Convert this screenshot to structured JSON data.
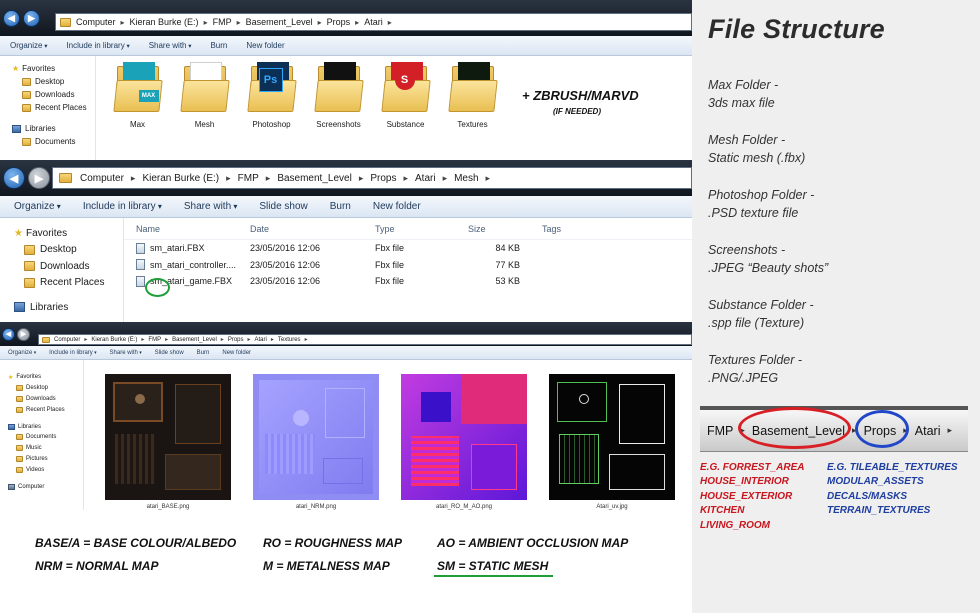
{
  "window1": {
    "breadcrumb": [
      "Computer",
      "Kieran Burke (E:)",
      "FMP",
      "Basement_Level",
      "Props",
      "Atari"
    ],
    "toolbar": [
      "Organize",
      "Include in library",
      "Share with",
      "Burn",
      "New folder"
    ],
    "nav": [
      {
        "label": "Favorites",
        "type": "group",
        "icon": "star-icon"
      },
      {
        "label": "Desktop",
        "type": "sub",
        "icon": "desktop-icon"
      },
      {
        "label": "Downloads",
        "type": "sub",
        "icon": "downloads-icon"
      },
      {
        "label": "Recent Places",
        "type": "sub",
        "icon": "recent-places-icon"
      },
      {
        "label": "",
        "type": "gap"
      },
      {
        "label": "Libraries",
        "type": "group",
        "icon": "libraries-icon"
      },
      {
        "label": "Documents",
        "type": "sub",
        "icon": "documents-icon"
      }
    ],
    "folders": [
      {
        "label": "Max",
        "badge": "MAX",
        "badge_color": "#1aa3b8"
      },
      {
        "label": "Mesh",
        "badge": "",
        "badge_color": ""
      },
      {
        "label": "Photoshop",
        "badge": "Ps",
        "badge_color": "#0b2f55"
      },
      {
        "label": "Screenshots",
        "badge": "",
        "badge_color": "#111111"
      },
      {
        "label": "Substance",
        "badge": "S",
        "badge_color": "#d32027"
      },
      {
        "label": "Textures",
        "badge": "",
        "badge_color": "#0d1a0d"
      }
    ],
    "extra_note": "+ ZBRUSH/MARVD",
    "extra_note_sub": "(IF NEEDED)"
  },
  "window2": {
    "breadcrumb": [
      "Computer",
      "Kieran Burke (E:)",
      "FMP",
      "Basement_Level",
      "Props",
      "Atari",
      "Mesh"
    ],
    "toolbar": [
      "Organize",
      "Include in library",
      "Share with",
      "Slide show",
      "Burn",
      "New folder"
    ],
    "nav": [
      {
        "label": "Favorites",
        "type": "group",
        "icon": "star-icon"
      },
      {
        "label": "Desktop",
        "type": "sub",
        "icon": "desktop-icon"
      },
      {
        "label": "Downloads",
        "type": "sub",
        "icon": "downloads-icon"
      },
      {
        "label": "Recent Places",
        "type": "sub",
        "icon": "recent-places-icon"
      },
      {
        "label": "",
        "type": "gap"
      },
      {
        "label": "Libraries",
        "type": "group",
        "icon": "libraries-icon"
      }
    ],
    "columns": [
      "Name",
      "Date",
      "Type",
      "Size",
      "Tags"
    ],
    "files": [
      {
        "name": "sm_atari.FBX",
        "date": "23/05/2016 12:06",
        "type": "Fbx file",
        "size": "84 KB"
      },
      {
        "name": "sm_atari_controller....",
        "date": "23/05/2016 12:06",
        "type": "Fbx file",
        "size": "77 KB"
      },
      {
        "name": "sm_atari_game.FBX",
        "date": "23/05/2016 12:06",
        "type": "Fbx file",
        "size": "53 KB"
      }
    ]
  },
  "window3": {
    "breadcrumb": [
      "Computer",
      "Kieran Burke (E:)",
      "FMP",
      "Basement_Level",
      "Props",
      "Atari",
      "Textures"
    ],
    "toolbar": [
      "Organize",
      "Include in library",
      "Share with",
      "Slide show",
      "Burn",
      "New folder"
    ],
    "nav": [
      {
        "label": "Favorites",
        "type": "group",
        "icon": "star-icon"
      },
      {
        "label": "Desktop",
        "type": "sub",
        "icon": "desktop-icon"
      },
      {
        "label": "Downloads",
        "type": "sub",
        "icon": "downloads-icon"
      },
      {
        "label": "Recent Places",
        "type": "sub",
        "icon": "recent-places-icon"
      },
      {
        "label": "",
        "type": "gap"
      },
      {
        "label": "Libraries",
        "type": "group",
        "icon": "libraries-icon"
      },
      {
        "label": "Documents",
        "type": "sub",
        "icon": "documents-icon"
      },
      {
        "label": "Music",
        "type": "sub",
        "icon": "music-icon"
      },
      {
        "label": "Pictures",
        "type": "sub",
        "icon": "pictures-icon"
      },
      {
        "label": "Videos",
        "type": "sub",
        "icon": "videos-icon"
      },
      {
        "label": "",
        "type": "gap"
      },
      {
        "label": "Computer",
        "type": "group",
        "icon": "computer-icon"
      }
    ],
    "thumbnails": [
      {
        "label": "atari_BASE.png",
        "kind": "base"
      },
      {
        "label": "atari_NRM.png",
        "kind": "nrm"
      },
      {
        "label": "atari_RO_M_AO.png",
        "kind": "rma"
      },
      {
        "label": "Atari_uv.jpg",
        "kind": "uv"
      }
    ]
  },
  "legend": {
    "base": "BASE/A = BASE COLOUR/ALBEDO",
    "nrm": "NRM = NORMAL MAP",
    "ro": "RO = ROUGHNESS MAP",
    "m": "M = METALNESS MAP",
    "ao": "AO = AMBIENT OCCLUSION MAP",
    "sm": "SM = STATIC MESH"
  },
  "panel": {
    "title": "File Structure",
    "items": [
      {
        "line1": "Max Folder -",
        "line2": "3ds max file"
      },
      {
        "line1": "Mesh Folder -",
        "line2": "Static mesh (.fbx)"
      },
      {
        "line1": "Photoshop Folder -",
        "line2": ".PSD texture file"
      },
      {
        "line1": "Screenshots -",
        "line2": ".JPEG “Beauty shots”"
      },
      {
        "line1": "Substance Folder -",
        "line2": ".spp file (Texture)"
      },
      {
        "line1": "Textures Folder -",
        "line2": ".PNG/.JPEG"
      }
    ],
    "crumbbar": [
      "FMP",
      "Basement_Level",
      "Props",
      "Atari"
    ],
    "examples_red": [
      "E.G. FORREST_AREA",
      "HOUSE_INTERIOR",
      "HOUSE_EXTERIOR",
      "KITCHEN",
      "LIVING_ROOM"
    ],
    "examples_blue": [
      "E.G. TILEABLE_TEXTURES",
      "MODULAR_ASSETS",
      "DECALS/MASKS",
      "TERRAIN_TEXTURES"
    ],
    "red_color": "#c8161e",
    "blue_color": "#1e3ea0"
  }
}
